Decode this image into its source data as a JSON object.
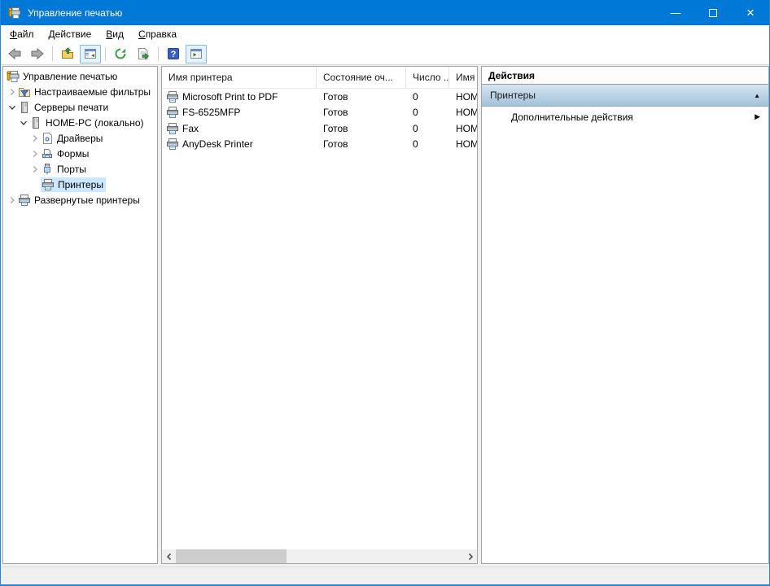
{
  "window": {
    "title": "Управление печатью",
    "controls": {
      "minimize": "—",
      "close": "×"
    }
  },
  "colors": {
    "titlebar": "#0078d7",
    "tree_selection": "#cce8ff",
    "actions_section_top": "#d6e5f1",
    "actions_section_bottom": "#a3c2da"
  },
  "menubar": {
    "items": [
      {
        "label": "Файл"
      },
      {
        "label": "Действие"
      },
      {
        "label": "Вид"
      },
      {
        "label": "Справка"
      }
    ]
  },
  "toolbar": {
    "buttons": [
      {
        "icon": "back-arrow-icon",
        "pressed": false
      },
      {
        "icon": "forward-arrow-icon",
        "pressed": false
      },
      {
        "icon": "up-one-level-icon",
        "pressed": false
      },
      {
        "icon": "console-tree-toggle-icon",
        "pressed": true
      },
      {
        "icon": "refresh-icon",
        "pressed": false
      },
      {
        "icon": "export-list-icon",
        "pressed": false
      },
      {
        "icon": "help-icon",
        "pressed": false
      },
      {
        "icon": "action-pane-toggle-icon",
        "pressed": true
      }
    ]
  },
  "tree": {
    "items": [
      {
        "label": "Управление печатью",
        "depth": 0,
        "expander": "none",
        "icon": "print-management-icon",
        "selected": false
      },
      {
        "label": "Настраиваемые фильтры",
        "depth": 1,
        "expander": "collapsed",
        "icon": "filter-folder-icon",
        "selected": false
      },
      {
        "label": "Серверы печати",
        "depth": 1,
        "expander": "expanded",
        "icon": "server-icon",
        "selected": false
      },
      {
        "label": "HOME-PC (локально)",
        "depth": 2,
        "expander": "expanded",
        "icon": "server-icon",
        "selected": false
      },
      {
        "label": "Драйверы",
        "depth": 3,
        "expander": "collapsed",
        "icon": "driver-icon",
        "selected": false
      },
      {
        "label": "Формы",
        "depth": 3,
        "expander": "collapsed",
        "icon": "forms-icon",
        "selected": false
      },
      {
        "label": "Порты",
        "depth": 3,
        "expander": "collapsed",
        "icon": "ports-icon",
        "selected": false
      },
      {
        "label": "Принтеры",
        "depth": 3,
        "expander": "none",
        "icon": "printer-icon",
        "selected": true
      },
      {
        "label": "Развернутые принтеры",
        "depth": 1,
        "expander": "collapsed",
        "icon": "deployed-printers-icon",
        "selected": false
      }
    ]
  },
  "list": {
    "columns": [
      {
        "label": "Имя принтера"
      },
      {
        "label": "Состояние оч..."
      },
      {
        "label": "Число ..."
      },
      {
        "label": "Имя сервера"
      }
    ],
    "rows": [
      {
        "name": "Microsoft Print to PDF",
        "status": "Готов",
        "jobs": "0",
        "server": "HOME-PC"
      },
      {
        "name": "FS-6525MFP",
        "status": "Готов",
        "jobs": "0",
        "server": "HOME-PC"
      },
      {
        "name": "Fax",
        "status": "Готов",
        "jobs": "0",
        "server": "HOME-PC"
      },
      {
        "name": "AnyDesk Printer",
        "status": "Готов",
        "jobs": "0",
        "server": "HOME-PC"
      }
    ]
  },
  "actions": {
    "title": "Действия",
    "section": {
      "label": "Принтеры",
      "state": "expanded",
      "collapse_glyph": "▲"
    },
    "items": [
      {
        "label": "Дополнительные действия",
        "arrow_glyph": "▶"
      }
    ]
  }
}
